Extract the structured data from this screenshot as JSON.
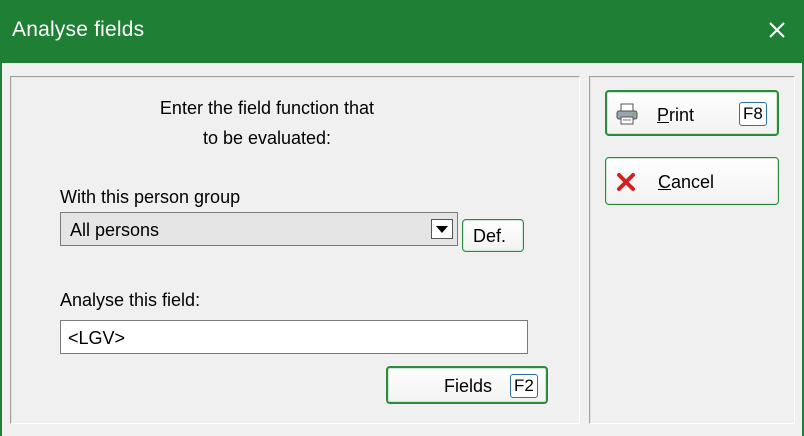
{
  "window": {
    "title": "Analyse fields",
    "close_icon": "close-icon",
    "accent_color": "#1e7f35"
  },
  "main": {
    "prompt_line1": "Enter the field function that",
    "prompt_line2": "to be evaluated:",
    "group_label": "With this person group",
    "group_value": "All persons",
    "def_label": "Def.",
    "field_label": "Analyse this field:",
    "field_value": "<LGV>",
    "fields_button": "Fields",
    "fields_key": "F2"
  },
  "actions": {
    "print_mnemonic": "P",
    "print_rest": "rint",
    "print_key": "F8",
    "print_icon": "printer-icon",
    "cancel_mnemonic": "C",
    "cancel_rest": "ancel",
    "cancel_icon": "cancel-x-icon"
  }
}
